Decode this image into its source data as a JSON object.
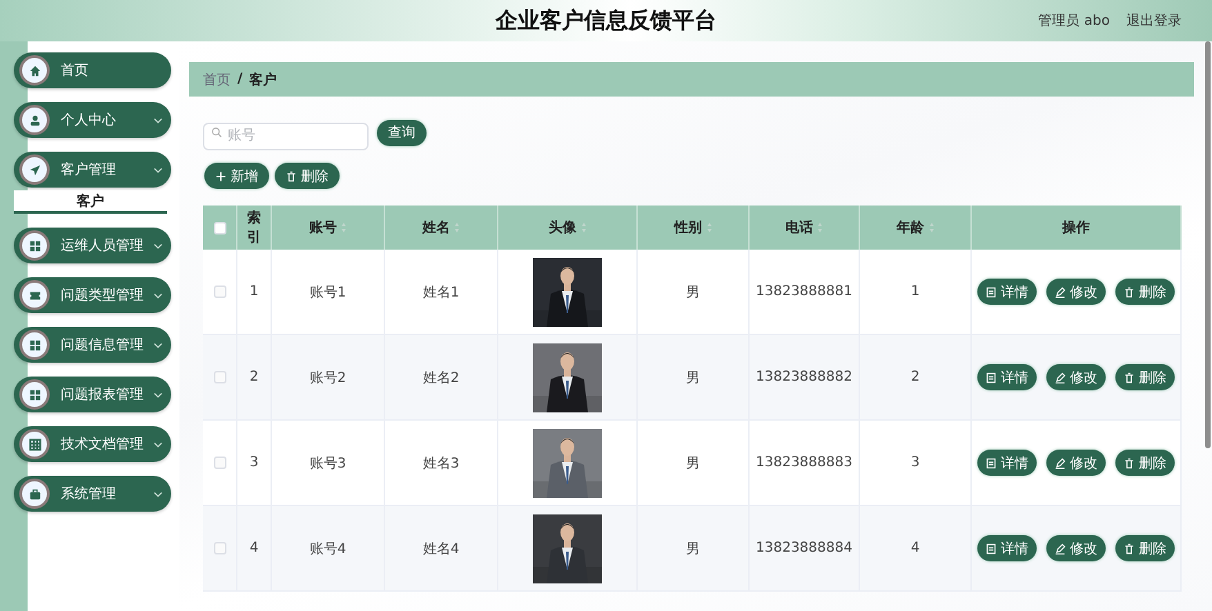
{
  "header": {
    "title": "企业客户信息反馈平台",
    "user": "管理员 abo",
    "logout": "退出登录"
  },
  "sidebar": {
    "items": [
      {
        "label": "首页",
        "kind": "link"
      },
      {
        "label": "个人中心",
        "kind": "menu"
      },
      {
        "label": "客户管理",
        "kind": "menu",
        "children": [
          {
            "label": "客户",
            "selected": true
          }
        ]
      },
      {
        "label": "运维人员管理",
        "kind": "menu"
      },
      {
        "label": "问题类型管理",
        "kind": "menu"
      },
      {
        "label": "问题信息管理",
        "kind": "menu"
      },
      {
        "label": "问题报表管理",
        "kind": "menu"
      },
      {
        "label": "技术文档管理",
        "kind": "menu"
      },
      {
        "label": "系统管理",
        "kind": "menu"
      }
    ]
  },
  "breadcrumb": [
    "首页",
    "/",
    "客户"
  ],
  "search": {
    "placeholder": "账号",
    "button": "查询"
  },
  "actions": [
    "新增",
    "删除"
  ],
  "table": {
    "columns": [
      {
        "label": "索引",
        "kind": "plain"
      },
      {
        "label": "账号",
        "kind": "sortable"
      },
      {
        "label": "姓名",
        "kind": "sortable"
      },
      {
        "label": "头像",
        "kind": "sortable"
      },
      {
        "label": "性别",
        "kind": "sortable"
      },
      {
        "label": "电话",
        "kind": "sortable"
      },
      {
        "label": "年龄",
        "kind": "sortable"
      },
      {
        "label": "操作",
        "kind": "plain"
      }
    ],
    "all_checked": false,
    "rows": [
      {
        "checked": false,
        "index": "1",
        "account": "账号1",
        "name": "姓名1",
        "avatar": {
          "kind": "picture"
        },
        "gender": "男",
        "phone": "13823888881",
        "age": "1",
        "actions": [
          "详情",
          "修改",
          "删除"
        ]
      },
      {
        "checked": false,
        "index": "2",
        "account": "账号2",
        "name": "姓名2",
        "avatar": {
          "kind": "picture"
        },
        "gender": "男",
        "phone": "13823888882",
        "age": "2",
        "actions": [
          "详情",
          "修改",
          "删除"
        ]
      },
      {
        "checked": false,
        "index": "3",
        "account": "账号3",
        "name": "姓名3",
        "avatar": {
          "kind": "picture"
        },
        "gender": "男",
        "phone": "13823888883",
        "age": "3",
        "actions": [
          "详情",
          "修改",
          "删除"
        ]
      },
      {
        "checked": false,
        "index": "4",
        "account": "账号4",
        "name": "姓名4",
        "avatar": {
          "kind": "picture"
        },
        "gender": "男",
        "phone": "13823888884",
        "age": "4",
        "actions": [
          "详情",
          "修改",
          "删除"
        ]
      }
    ]
  }
}
